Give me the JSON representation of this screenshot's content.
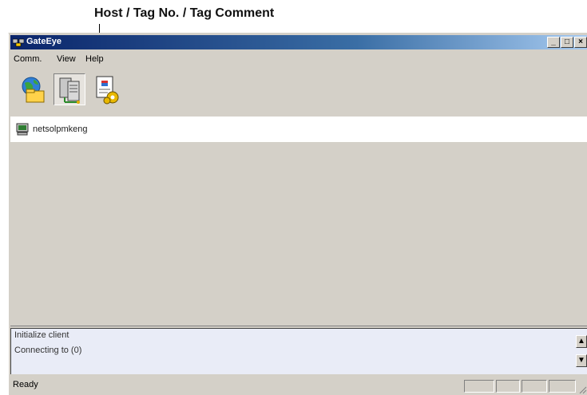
{
  "callout": {
    "label": "Host / Tag No. / Tag Comment"
  },
  "window": {
    "title": "GateEye",
    "controls": {
      "minimize": "_",
      "maximize": "□",
      "close": "×"
    }
  },
  "menu": {
    "items": [
      "Comm.",
      "View",
      "Help"
    ]
  },
  "toolbar": {
    "buttons": [
      {
        "icon": "network-globe-icon",
        "pressed": false
      },
      {
        "icon": "server-tag-icon",
        "pressed": true
      },
      {
        "icon": "document-settings-icon",
        "pressed": false
      }
    ]
  },
  "list": {
    "items": [
      {
        "icon": "computer-icon",
        "label": "netsolpmkeng"
      }
    ]
  },
  "log": {
    "lines": [
      "Initialize client",
      "Connecting to (0)"
    ]
  },
  "statusbar": {
    "text": "Ready"
  },
  "colors": {
    "titlebar_start": "#0a246a",
    "titlebar_end": "#a6caf0",
    "log_background": "#e9ecf7"
  }
}
